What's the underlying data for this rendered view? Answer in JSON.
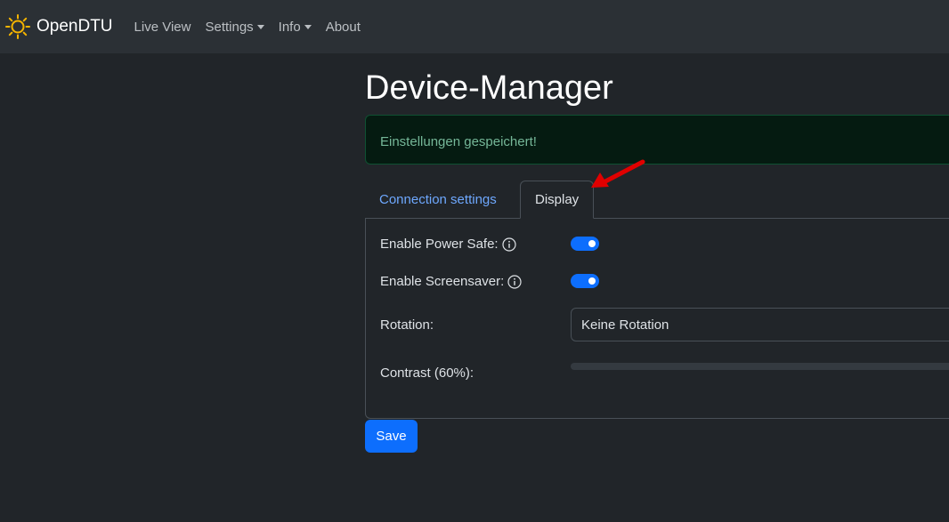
{
  "navbar": {
    "brand": "OpenDTU",
    "items": [
      {
        "label": "Live View",
        "dropdown": false
      },
      {
        "label": "Settings",
        "dropdown": true
      },
      {
        "label": "Info",
        "dropdown": true
      },
      {
        "label": "About",
        "dropdown": false
      }
    ]
  },
  "page": {
    "title": "Device-Manager",
    "alert": "Einstellungen gespeichert!"
  },
  "tabs": [
    {
      "label": "Connection settings",
      "active": false
    },
    {
      "label": "Display",
      "active": true
    }
  ],
  "display": {
    "power_safe_label": "Enable Power Safe:",
    "power_safe_on": true,
    "screensaver_label": "Enable Screensaver:",
    "screensaver_on": true,
    "rotation_label": "Rotation:",
    "rotation_value": "Keine Rotation",
    "contrast_label": "Contrast (60%):",
    "contrast_percent": 60
  },
  "actions": {
    "save_label": "Save"
  },
  "icons": {
    "brand": "sun-icon",
    "info": "info-circle-icon",
    "annotation": "red-arrow"
  },
  "colors": {
    "accent": "#0d6efd",
    "link": "#6ea8fe",
    "brand_icon": "#f5b400",
    "alert_text": "#75b798",
    "annotation": "#e00000"
  }
}
